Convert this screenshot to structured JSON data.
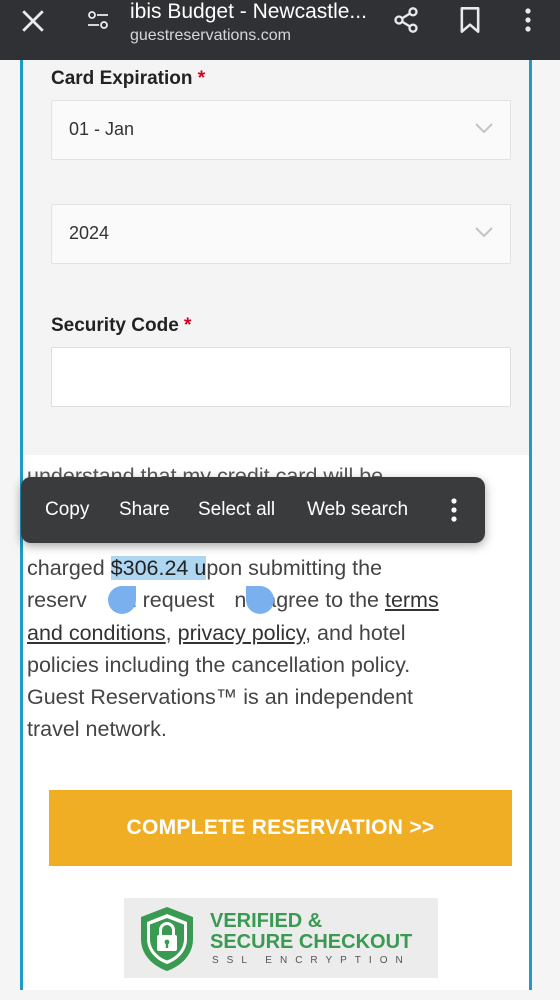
{
  "browser": {
    "page_title": "ibis Budget - Newcastle...",
    "url": "guestreservations.com"
  },
  "form": {
    "card_expiration_label": "Card Expiration",
    "required_mark": "*",
    "month_value": "01 - Jan",
    "year_value": "2024",
    "security_code_label": "Security Code",
    "security_code_value": ""
  },
  "context_menu": {
    "items": [
      "Copy",
      "Share",
      "Select all",
      "Web search"
    ]
  },
  "terms": {
    "line0_partial": "understand that my credit card will be",
    "charged_prefix": "charged ",
    "amount_selected": "$306.24 u",
    "after_amount": "pon submitting the",
    "line2_a": "reserv",
    "line2_b": "on request",
    "line2_c": "nd agree to the ",
    "terms_link_1": "terms",
    "terms_link_2": "and conditions",
    "comma": ", ",
    "privacy_link": "privacy policy",
    "line3_rest": ", and hotel",
    "line4": "policies including the cancellation policy.",
    "line5": "Guest Reservations™ is an independent",
    "line6": "travel network."
  },
  "cta": {
    "label": "COMPLETE RESERVATION >>"
  },
  "badge": {
    "line1": "VERIFIED &",
    "line2": "SECURE CHECKOUT",
    "line3": "SSL ENCRYPTION"
  },
  "colors": {
    "frame_accent": "#1e9bc6",
    "cta": "#f0ae25",
    "badge_green": "#3a9a52",
    "selection": "#aed6f1",
    "required": "#d0021b"
  },
  "icons": [
    "close-icon",
    "tune-icon",
    "share-icon",
    "bookmark-icon",
    "more-vert-icon",
    "chevron-down-icon",
    "shield-lock-icon"
  ]
}
